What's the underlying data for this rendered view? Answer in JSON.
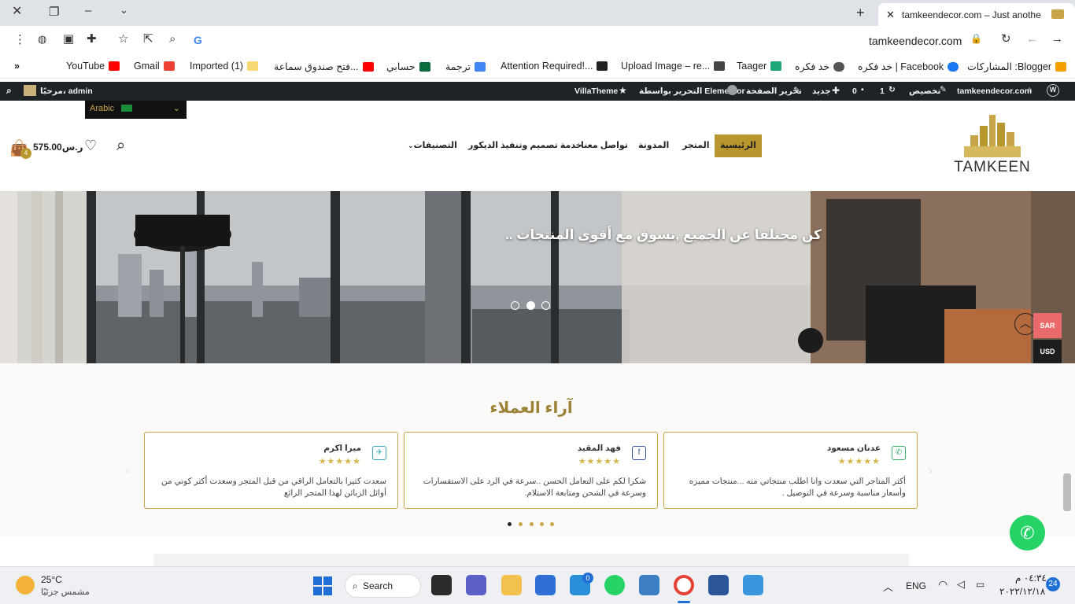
{
  "browser": {
    "tab_title": "tamkeendecor.com – Just anothe",
    "url": "tamkeendecor.com",
    "bookmarks": [
      {
        "label": "المشاركات :Blogger",
        "color": "#f4a000"
      },
      {
        "label": "خد فكره | Facebook",
        "color": "#1877f2"
      },
      {
        "label": "خد فكره",
        "color": "#555"
      },
      {
        "label": "Taager",
        "color": "#21a67a"
      },
      {
        "label": "Upload Image – re...",
        "color": "#444"
      },
      {
        "label": "Attention Required!...",
        "color": "#222"
      },
      {
        "label": "ترجمة",
        "color": "#4285f4"
      },
      {
        "label": "حسابي",
        "color": "#0b6b3a"
      },
      {
        "label": "فتح صندوق سماعة...",
        "color": "#ff0000"
      },
      {
        "label": "Imported (1)",
        "color": "#f6d776"
      },
      {
        "label": "Gmail",
        "color": "#ea4335"
      },
      {
        "label": "YouTube",
        "color": "#ff0000"
      }
    ]
  },
  "adminbar": {
    "site": "tamkeendecor.com",
    "customize": "تخصيص",
    "updates": "1",
    "comments": "0",
    "new": "جديد",
    "edit_page": "تحرير الصفحة",
    "elementor": "التحرير بواسطة Elementor",
    "villatheme": "VillaTheme",
    "greeting": "مرحبًا، admin"
  },
  "header": {
    "lang": "Arabic",
    "logo_text": "TAMKEEN",
    "cart_total": "575.00ر.س",
    "cart_count": "4",
    "menu": [
      "الرئيسية",
      "المتجر",
      "المدونة",
      "تواصل معنا",
      "خدمة تصميم وتنفيذ الديكور",
      "التصنيفات"
    ]
  },
  "hero": {
    "headline": "كن مختلفا عن الجميع ,تسوق مع أقوى المنتجات ..",
    "currency_sar": "SAR",
    "currency_usd": "USD"
  },
  "reviews": {
    "title": "آراء العملاء",
    "stars": "★★★★★",
    "items": [
      {
        "name": "عدنان مسعود",
        "text": "أكثر المتاجر التي سعدت وانا اطلب منتجاتي منه ...منتجات مميزه وأسعار مناسبة وسرعة في التوصيل ."
      },
      {
        "name": "فهد المقيد",
        "text": "شكرا لكم على التعامل الحسن ..سرعة في الرد على الاستفسارات وسرعة في الشحن ومتابعة الاستلام."
      },
      {
        "name": "ميرا اكرم",
        "text": "سعدت كثيرا بالتعامل الراقي من قبل المتجر وسعدت أكثر كوني من أوائل الزبائن لهذا المتجر الرائع"
      }
    ]
  },
  "taskbar": {
    "temp": "25°C",
    "weather": "مشمس جزئيًا",
    "search": "Search",
    "lang": "ENG",
    "time": "٠٤:٣٤ م",
    "date": "٢٠٢٢/١٢/١٨",
    "notif": "24",
    "badge": "0"
  },
  "colors": {
    "gold": "#b8972f",
    "dark": "#1d2327",
    "whatsapp": "#25d366",
    "sar": "#e86a6a"
  }
}
